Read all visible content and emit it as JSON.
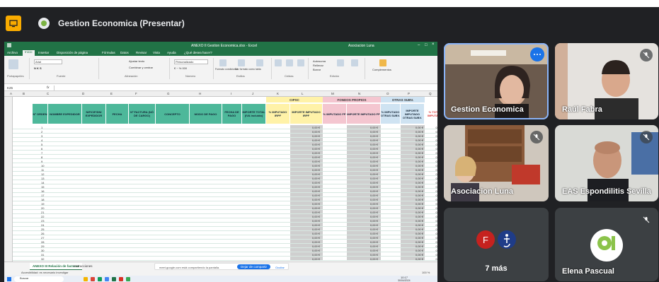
{
  "meet": {
    "present_title": "Gestion Economica (Presentar)"
  },
  "excel": {
    "title": "ANEXO II Gestion Economica.xlsx - Excel",
    "user": "Asociacion Luna",
    "tabs": [
      "Archivo",
      "Inicio",
      "Insertar",
      "Disposición de página",
      "Fórmulas",
      "Datos",
      "Revisar",
      "Vista",
      "Ayuda",
      "¿Qué desea hacer?"
    ],
    "active_tab": "Inicio",
    "ribbon": {
      "font": "Arial",
      "wrap": "Ajustar texto",
      "merge": "Combinar y centrar",
      "number_format": "Personalizado",
      "cond_format": "Formato condicional",
      "table_format": "Dar formato como tabla",
      "cell_styles": "Estilos de celda",
      "insert": "Insertar",
      "delete": "Eliminar",
      "format": "Formato",
      "autosum": "Autosuma",
      "fill": "Rellenar",
      "clear": "Borrar",
      "sort": "Ordenar y filtrar",
      "find": "Buscar y seleccionar",
      "addins": "Complementos",
      "group_clipboard": "Portapapeles",
      "group_font": "Fuente",
      "group_align": "Alineación",
      "group_number": "Número",
      "group_styles": "Estilos",
      "group_cells": "Celdas",
      "group_edit": "Edición"
    },
    "name_box": "K25",
    "columns": [
      "A",
      "B",
      "C",
      "D",
      "E",
      "F",
      "G",
      "H",
      "I",
      "J",
      "K",
      "L",
      "M",
      "N",
      "O",
      "P",
      "Q"
    ],
    "headers": {
      "orden": "Nº ORDEN",
      "nombre": "NOMBRE EXPEDIDOR",
      "nif": "NIF/CIF/DNI EXPEDIDOR",
      "fecha": "FECHA",
      "factura": "Nº FACTURA (NÓ DE CARGO)",
      "concepto": "CONCEPTO",
      "modo_pago": "MODO DE PAGO",
      "fecha_pago": "FECHA DE PAGO",
      "importe_total": "IMPORTE TOTAL (IVA incluido)",
      "cipsc": "CIPSC",
      "fondos": "FONDOS PROPIOS",
      "otras": "OTRAS SUBV.",
      "pct_imp_irpf": "% IMPUTADO IRPF",
      "imp_irpf": "IMPORTE IMPUTADO IRPF",
      "pct_fp": "% IMPUTADO FP",
      "imp_fp": "IMPORTE IMPUTADO FP",
      "pct_otras": "% IMPUTADO OTRAS SUBV.",
      "imp_otras": "IMPORTE IMPUTADO OTRAS SUBV.",
      "pct_total": "% TOTAL IMPUTADO"
    },
    "row_numbers": [
      "1",
      "2",
      "3",
      "4",
      "5",
      "6",
      "7",
      "8",
      "9",
      "10",
      "11",
      "12",
      "13",
      "14",
      "15",
      "16",
      "17",
      "18",
      "19",
      "20",
      "21",
      "22",
      "23",
      "24",
      "25",
      "26",
      "27",
      "28",
      "29",
      "30",
      "31",
      "32"
    ],
    "zero_euro": "0,00 €",
    "zero_pct": "0,00 %",
    "sheet_tab": "ANEXO III Relación de facturas",
    "sheet_tab2": "Instrucciones",
    "share_msg": "meet.google.com está compartiendo la pantalla.",
    "stop_share": "Dejar de compartir",
    "hide": "Ocultar",
    "status": "Accesibilidad: es necesario investigar",
    "zoom": "100 %",
    "search": "Buscar",
    "time": "10:17",
    "date": "30/04/2024"
  },
  "participants": [
    {
      "name": "Gestion Economica"
    },
    {
      "name": "Raúl Fabra"
    },
    {
      "name": "Asociacion Luna"
    },
    {
      "name": "EAS Espondilitis Sevilla"
    },
    {
      "name": "7 más",
      "avatar_letter": "F"
    },
    {
      "name": "Elena Pascual"
    }
  ],
  "colors": {
    "meet_bg": "#202124",
    "excel_green": "#217346",
    "header_teal": "#4db89a",
    "cipsc_yellow": "#fff2a8",
    "fondos_pink": "#f4c6d0",
    "otras_blue": "#cfe3f2",
    "grey_col": "#c8c8c8",
    "avatar_red": "#c5221f",
    "avatar_navy": "#1f3c88"
  }
}
